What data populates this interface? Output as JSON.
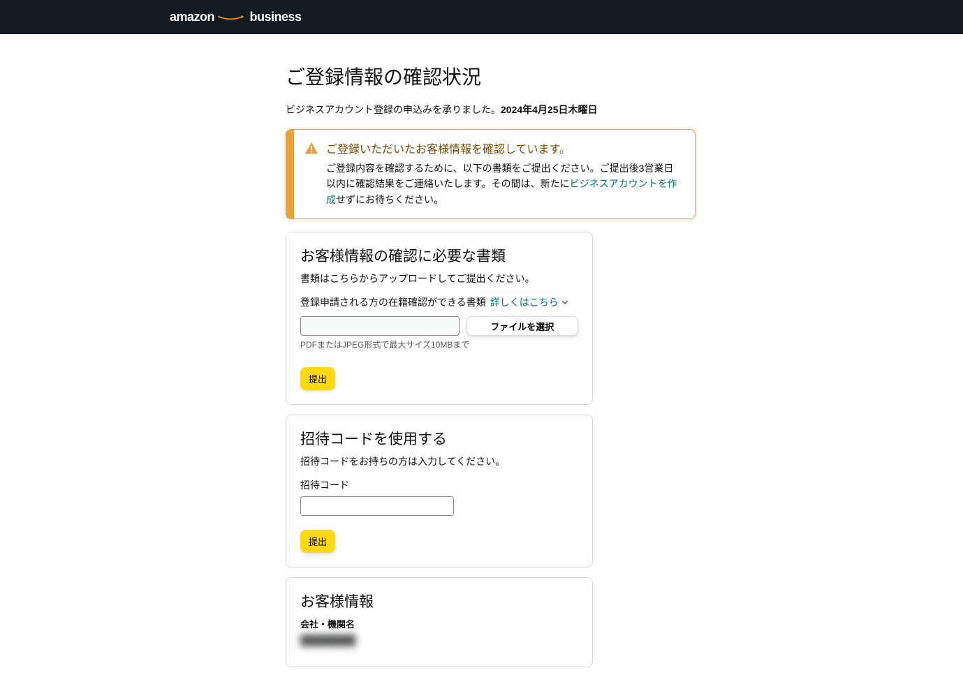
{
  "header": {
    "logo_amazon": "amazon",
    "logo_business": "business"
  },
  "page": {
    "title": "ご登録情報の確認状況",
    "subtitle_prefix": "ビジネスアカウント登録の申込みを承りました。",
    "subtitle_date": "2024年4月25日木曜日"
  },
  "alert": {
    "title": "ご登録いただいたお客様情報を確認しています。",
    "body_before": "ご登録内容を確認するために、以下の書類をご提出ください。ご提出後3営業日以内に確認結果をご連絡いたします。その間は、新たに",
    "body_link": "ビジネスアカウントを作成",
    "body_after": "せずにお待ちください。"
  },
  "upload_card": {
    "title": "お客様情報の確認に必要な書類",
    "desc": "書類はこちらからアップロードしてご提出ください。",
    "doc_label": "登録申請される方の在籍確認ができる書類",
    "expand_link": "詳しくはこちら",
    "file_button": "ファイルを選択",
    "file_hint": "PDFまたはJPEG形式で最大サイズ10MBまで",
    "submit": "提出"
  },
  "invite_card": {
    "title": "招待コードを使用する",
    "desc": "招待コードをお持ちの方は入力してください。",
    "field_label": "招待コード",
    "submit": "提出"
  },
  "info_card": {
    "title": "お客様情報",
    "company_label": "会社・機関名",
    "company_value": "████████"
  }
}
